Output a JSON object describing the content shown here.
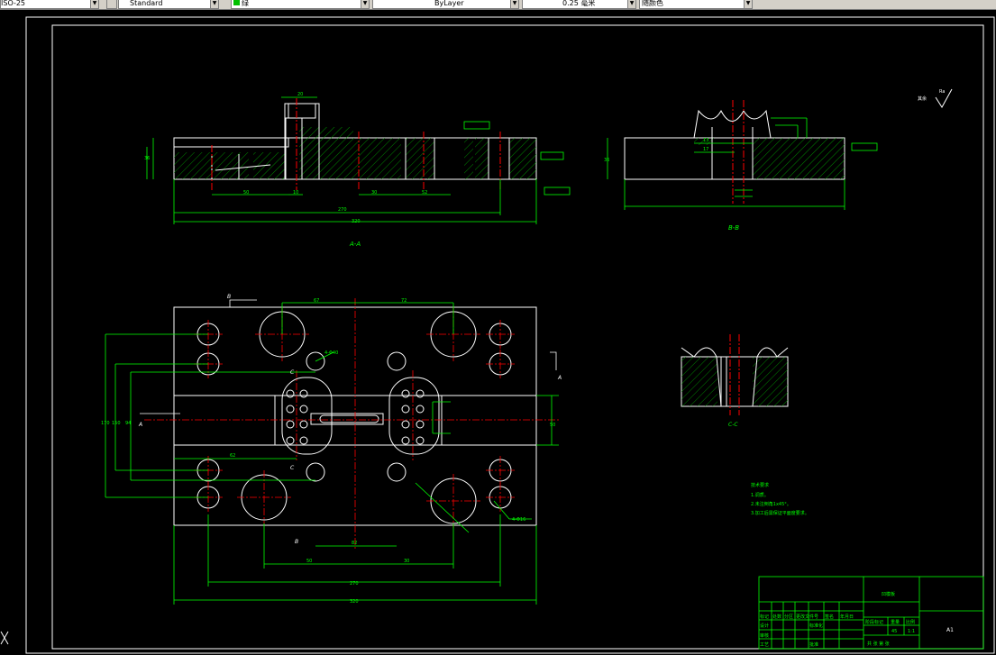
{
  "toolbar": {
    "fields": [
      {
        "name": "text-style-dropdown",
        "value": "ISO-25"
      },
      {
        "name": "dim-style-dropdown",
        "value": "Standard"
      },
      {
        "name": "layer-dropdown",
        "value": "绿"
      },
      {
        "name": "linetype-dropdown",
        "value": "ByLayer"
      },
      {
        "name": "lineweight-dropdown",
        "value": "0.25 毫米"
      },
      {
        "name": "plotstyle-dropdown",
        "value": "随颜色"
      }
    ]
  },
  "colors": {
    "background": "#000000",
    "outline": "#ffffff",
    "dimension": "#00ff00",
    "centerline": "#ff0000",
    "hatch": "#00aa00",
    "titleblock": "#00ff00"
  },
  "drawing": {
    "sections": {
      "aa": "A-A",
      "bb": "B-B",
      "cc": "C-C"
    },
    "labels": {
      "cut_a_left": "A",
      "cut_a_right": "A",
      "cut_b_top": "B",
      "cut_b_bottom": "B",
      "cut_c_top": "C",
      "cut_c_bottom": "C"
    },
    "dims": {
      "aa_overall": "320",
      "aa_inner": "270",
      "aa_d1": "50",
      "aa_d2": "10",
      "aa_d3": "30",
      "aa_d4": "52",
      "aa_height": "36",
      "aa_top": "20",
      "bb_width": "36",
      "bb_d1": "13",
      "bb_d2": "17",
      "plan_overall": "320",
      "plan_inner": "270",
      "plan_top1": "67",
      "plan_top2": "72",
      "plan_d1": "50",
      "plan_d2": "30",
      "plan_d3": "82",
      "plan_d4": "62",
      "plan_left1": "170",
      "plan_left2": "150",
      "plan_left3": "94",
      "plan_right": "50",
      "hole_note": "4-Φ40",
      "hole_note2": "4-Φ16"
    },
    "roughness": "Ra",
    "roughness_note": "其余"
  },
  "notes": {
    "title": "技术要求",
    "lines": [
      "1.调质。",
      "2.未注倒角1x45°。",
      "3.加工后需保证平面度要求。"
    ]
  },
  "titleblock": {
    "part_name": "凹模板",
    "header_cells": [
      "标记",
      "处数",
      "分区",
      "更改文件号",
      "签名",
      "年月日"
    ],
    "row2": [
      "设计",
      "",
      "",
      "标准化",
      ""
    ],
    "row3": [
      "审核"
    ],
    "row4": [
      "工艺",
      "",
      "",
      "批准"
    ],
    "labels": [
      "阶段标记",
      "重量",
      "比例"
    ],
    "material": "45",
    "scale": "1:1",
    "sheet": "共 张 第 张",
    "size": "A1"
  }
}
